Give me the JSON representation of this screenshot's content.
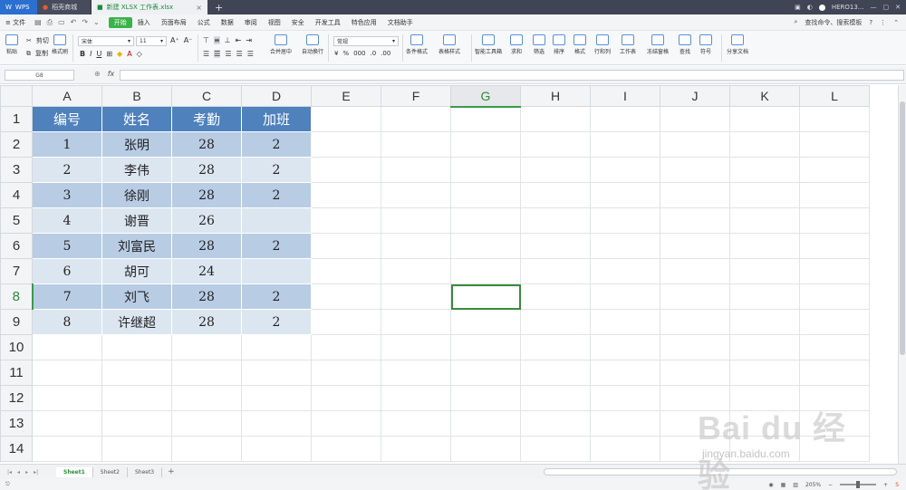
{
  "titlebar": {
    "tabs": [
      {
        "label": "WPS"
      },
      {
        "label": "稻壳商城"
      },
      {
        "label": "新建 XLSX 工作表.xlsx"
      }
    ],
    "new_tab": "+",
    "user": "HERO13..."
  },
  "menubar": {
    "file": "≡ 文件",
    "items": [
      "开始",
      "插入",
      "页面布局",
      "公式",
      "数据",
      "审阅",
      "视图",
      "安全",
      "开发工具",
      "特色应用",
      "文档助手"
    ],
    "search": "查找命令、搜索模板"
  },
  "ribbon": {
    "paste": "粘贴",
    "cut": "剪切",
    "copy": "复制",
    "format_painter": "格式刷",
    "font_name": "宋体",
    "font_size": "11",
    "merge_center": "合并居中",
    "wrap_text": "自动换行",
    "number_format": "常规",
    "conditional_format": "条件格式",
    "table_style": "表格样式",
    "smart_toolbox": "智能工具箱",
    "sum": "求和",
    "filter": "筛选",
    "sort": "排序",
    "format": "格式",
    "row_col": "行和列",
    "worksheet": "工作表",
    "freeze": "冻结窗格",
    "find": "查找",
    "symbol": "符号",
    "share": "分享文档"
  },
  "formula": {
    "cell_ref": "G8",
    "fx": "fx",
    "value": ""
  },
  "columns": [
    "A",
    "B",
    "C",
    "D",
    "E",
    "F",
    "G",
    "H",
    "I",
    "J",
    "K",
    "L"
  ],
  "rows": [
    "1",
    "2",
    "3",
    "4",
    "5",
    "6",
    "7",
    "8",
    "9",
    "10",
    "11",
    "12",
    "13",
    "14"
  ],
  "active_cell": {
    "column": "G",
    "row": "8"
  },
  "table": {
    "headers": [
      "编号",
      "姓名",
      "考勤",
      "加班"
    ],
    "data": [
      [
        "1",
        "张明",
        "28",
        "2"
      ],
      [
        "2",
        "李伟",
        "28",
        "2"
      ],
      [
        "3",
        "徐刚",
        "28",
        "2"
      ],
      [
        "4",
        "谢晋",
        "26",
        ""
      ],
      [
        "5",
        "刘富民",
        "28",
        "2"
      ],
      [
        "6",
        "胡可",
        "24",
        ""
      ],
      [
        "7",
        "刘飞",
        "28",
        "2"
      ],
      [
        "8",
        "许继超",
        "28",
        "2"
      ]
    ]
  },
  "sheets": [
    "Sheet1",
    "Sheet2",
    "Sheet3"
  ],
  "active_sheet": "Sheet1",
  "status": {
    "zoom": "205%"
  },
  "watermark": {
    "logo": "Bai du 经验",
    "url": "jingyan.baidu.com"
  },
  "colors": {
    "header_fill": "#4f81bd",
    "dark_band": "#b8cce4",
    "light_band": "#dce6f1",
    "accent_green": "#3bb24a"
  }
}
